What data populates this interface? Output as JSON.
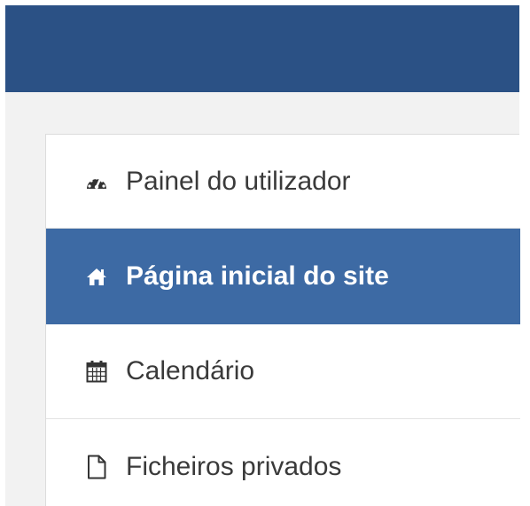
{
  "header": {
    "color": "#2b5185"
  },
  "nav": {
    "items": [
      {
        "label": "Painel do utilizador",
        "icon": "dashboard-icon",
        "active": false
      },
      {
        "label": "Página inicial do site",
        "icon": "home-icon",
        "active": true
      },
      {
        "label": "Calendário",
        "icon": "calendar-icon",
        "active": false
      },
      {
        "label": "Ficheiros privados",
        "icon": "file-icon",
        "active": false
      }
    ],
    "active_color": "#3d6aa4"
  }
}
